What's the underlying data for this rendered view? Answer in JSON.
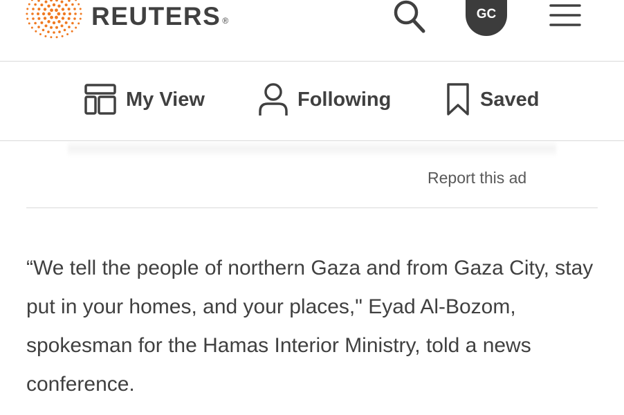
{
  "header": {
    "brand": "REUTERS",
    "registered_mark": "®",
    "avatar_initials": "GC",
    "icons": {
      "logo": "reuters-dot-logo",
      "search": "search-icon",
      "menu": "hamburger-menu-icon"
    },
    "logo_color": "#f07a22"
  },
  "nav": {
    "items": [
      {
        "label": "My View",
        "icon": "layout-icon"
      },
      {
        "label": "Following",
        "icon": "person-icon"
      },
      {
        "label": "Saved",
        "icon": "bookmark-icon"
      }
    ]
  },
  "ad": {
    "report_label": "Report this ad"
  },
  "article": {
    "paragraph": "“We tell the people of northern Gaza and from Gaza City, stay put in your homes, and your places,\" Eyad Al-Bozom, spokesman for the Hamas Interior Ministry, told a news conference."
  }
}
